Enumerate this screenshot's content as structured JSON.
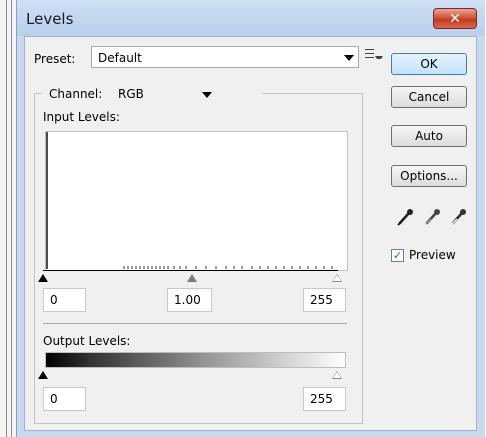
{
  "window": {
    "title": "Levels",
    "close_glyph": "✕"
  },
  "preset": {
    "label": "Preset:",
    "value": "Default",
    "menu_icon": "list-menu-icon"
  },
  "channel": {
    "label": "Channel:",
    "value": "RGB"
  },
  "input_levels": {
    "label": "Input Levels:",
    "black_point": "0",
    "gamma": "1.00",
    "white_point": "255"
  },
  "output_levels": {
    "label": "Output Levels:",
    "black_point": "0",
    "white_point": "255"
  },
  "buttons": {
    "ok": "OK",
    "cancel": "Cancel",
    "auto": "Auto",
    "options": "Options..."
  },
  "eyedroppers": [
    "black-eyedropper-icon",
    "gray-eyedropper-icon",
    "white-eyedropper-icon"
  ],
  "preview": {
    "label": "Preview",
    "checked": true,
    "check_glyph": "✓"
  },
  "colors": {
    "title_bar": "#c9daf0",
    "close_button": "#c8452a",
    "ok_button": "#c2e2fb",
    "client_bg": "#f0f0f0"
  }
}
